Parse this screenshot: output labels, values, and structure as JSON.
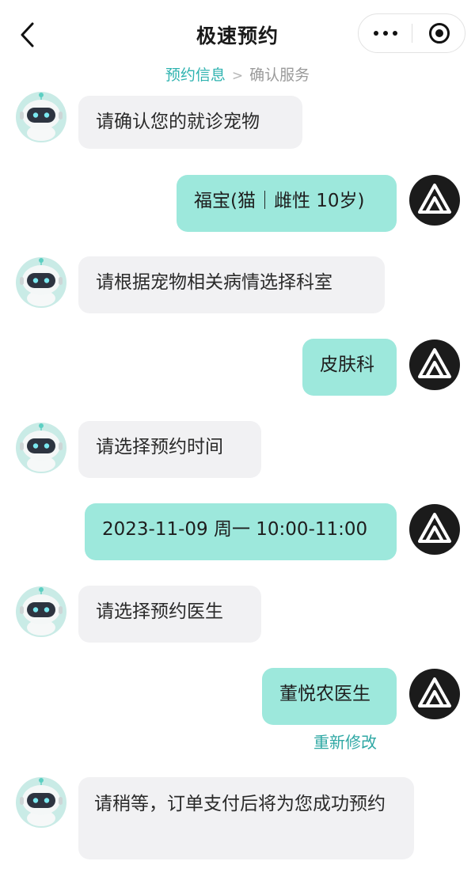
{
  "header": {
    "title": "极速预约",
    "back_icon": "chevron-left-icon",
    "menu_icon": "more-dots-icon",
    "close_icon": "target-circle-icon"
  },
  "steps": {
    "current": "预约信息",
    "separator": ">",
    "next": "确认服务"
  },
  "colors": {
    "accent": "#2fb3b0",
    "user_bubble": "#9de8dc",
    "bot_bubble": "#f1f1f3",
    "user_avatar": "#1b1b1b"
  },
  "chat": {
    "messages": [
      {
        "from": "bot",
        "text": "请确认您的就诊宠物"
      },
      {
        "from": "user",
        "text": "福宝(猫｜雌性 10岁)"
      },
      {
        "from": "bot",
        "text": "请根据宠物相关病情选择科室"
      },
      {
        "from": "user",
        "text": "皮肤科"
      },
      {
        "from": "bot",
        "text": "请选择预约时间"
      },
      {
        "from": "user",
        "text": "2023-11-09 周一 10:00-11:00"
      },
      {
        "from": "bot",
        "text": "请选择预约医生"
      },
      {
        "from": "user",
        "text": "董悦农医生"
      },
      {
        "from": "bot",
        "text": "请稍等，订单支付后将为您成功预约"
      }
    ],
    "edit_label": "重新修改"
  }
}
